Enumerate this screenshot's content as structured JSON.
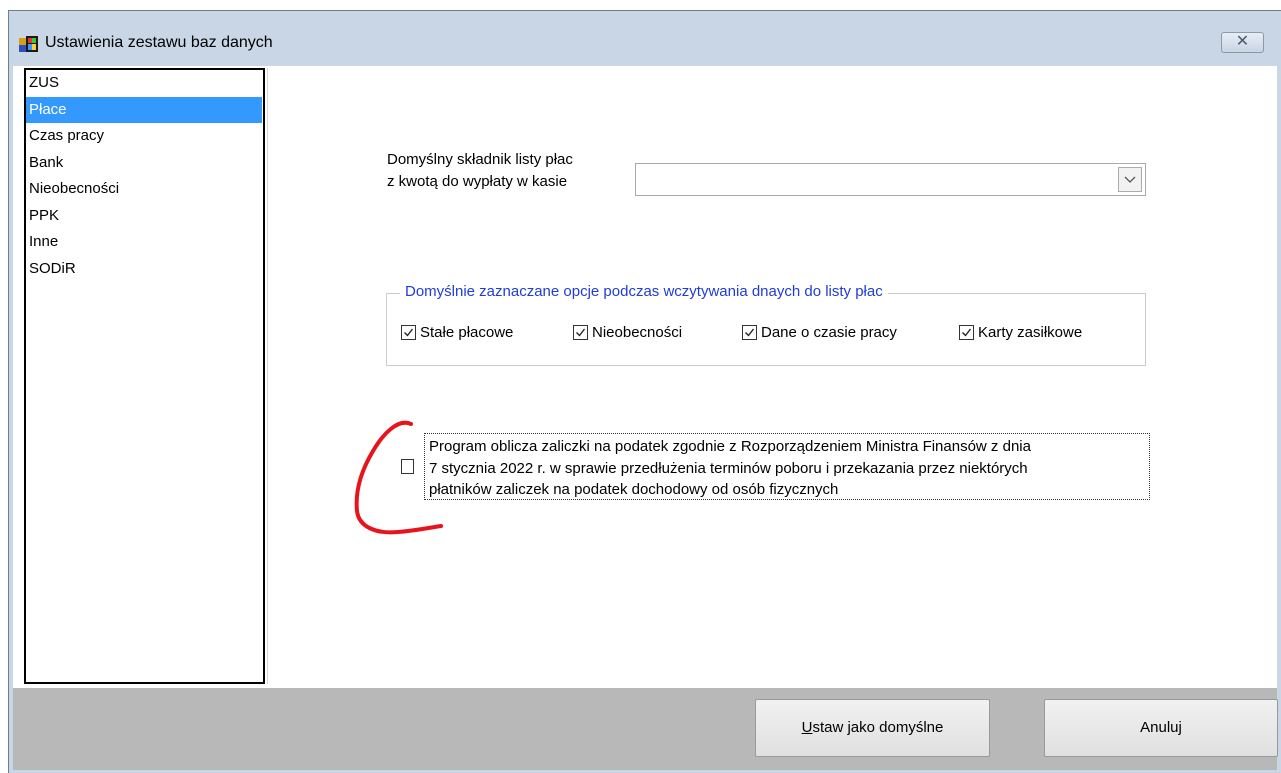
{
  "window": {
    "title": "Ustawienia zestawu baz danych",
    "close_glyph": "✕"
  },
  "nav": {
    "items": [
      "ZUS",
      "Płace",
      "Czas pracy",
      "Bank",
      "Nieobecności",
      "PPK",
      "Inne",
      "SODiR"
    ],
    "selected": "Płace"
  },
  "payroll": {
    "default_component_label_line1": "Domyślny składnik listy płac",
    "default_component_label_line2": "z kwotą do wypłaty w kasie",
    "default_component_value": ""
  },
  "import_options": {
    "group_title": "Domyślnie zaznaczane opcje podczas wczytywania dnaych do listy płac",
    "options": [
      {
        "label": "Stałe płacowe",
        "checked": true
      },
      {
        "label": "Nieobecności",
        "checked": true
      },
      {
        "label": "Dane o czasie pracy",
        "checked": true
      },
      {
        "label": "Karty zasiłkowe",
        "checked": true
      }
    ]
  },
  "tax_option": {
    "checked": false,
    "line1": "Program oblicza zaliczki na podatek zgodnie z Rozporządzeniem Ministra Finansów z dnia",
    "line2": "7 stycznia 2022 r. w sprawie przedłużenia terminów poboru i przekazania przez niektórych",
    "line3": "płatników zaliczek na podatek dochodowy od osób fizycznych"
  },
  "buttons": {
    "set_default_mnemonic": "U",
    "set_default_rest": "staw jako domyślne",
    "cancel_label": "Anuluj"
  },
  "colors": {
    "selection": "#3399ff",
    "group_title": "#1f3dd8",
    "annotation": "#e8141b"
  }
}
